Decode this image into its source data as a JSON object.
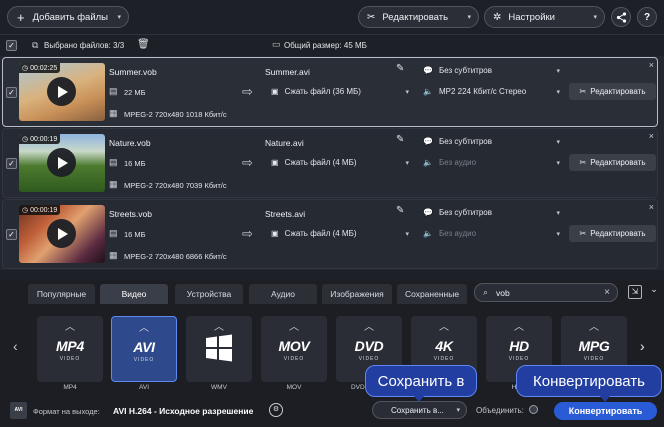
{
  "toolbar": {
    "add_files": "Добавить файлы",
    "edit": "Редактировать",
    "settings": "Настройки"
  },
  "selection": {
    "selected": "Выбрано файлов: 3/3",
    "total_size": "Общий размер: 45 МБ"
  },
  "files": [
    {
      "duration": "00:02:25",
      "src_name": "Summer.vob",
      "size": "22 МБ",
      "codec": "MPEG-2 720x480 1018 Кбит/с",
      "out_name": "Summer.avi",
      "compress": "Сжать файл (36 МБ)",
      "subtitles": "Без субтитров",
      "audio": "MP2 224 Кбит/с Стерео",
      "audio_disabled": false,
      "edit": "Редактировать"
    },
    {
      "duration": "00:00:19",
      "src_name": "Nature.vob",
      "size": "16 МБ",
      "codec": "MPEG-2 720x480 7039 Кбит/с",
      "out_name": "Nature.avi",
      "compress": "Сжать файл (4 МБ)",
      "subtitles": "Без субтитров",
      "audio": "Без аудио",
      "audio_disabled": true,
      "edit": "Редактировать"
    },
    {
      "duration": "00:00:19",
      "src_name": "Streets.vob",
      "size": "16 МБ",
      "codec": "MPEG-2 720x480 6866 Кбит/с",
      "out_name": "Streets.avi",
      "compress": "Сжать файл (4 МБ)",
      "subtitles": "Без субтитров",
      "audio": "Без аудио",
      "audio_disabled": true,
      "edit": "Редактировать"
    }
  ],
  "tabs": [
    "Популярные",
    "Видео",
    "Устройства",
    "Аудио",
    "Изображения",
    "Сохраненные"
  ],
  "active_tab": "Видео",
  "search": {
    "value": "vob"
  },
  "formats": [
    {
      "logo": "MP4",
      "sub": "VIDEO",
      "label": "MP4"
    },
    {
      "logo": "AVI",
      "sub": "VIDEO",
      "label": "AVI"
    },
    {
      "logo": "",
      "sub": "",
      "label": "WMV"
    },
    {
      "logo": "MOV",
      "sub": "VIDEO",
      "label": "MOV"
    },
    {
      "logo": "DVD",
      "sub": "VIDEO",
      "label": "DVD-совм..."
    },
    {
      "logo": "4K",
      "sub": "VIDEO",
      "label": ""
    },
    {
      "logo": "HD",
      "sub": "VIDEO",
      "label": "HD..."
    },
    {
      "logo": "MPG",
      "sub": "VIDEO",
      "label": "MPG"
    }
  ],
  "footer": {
    "output_format_label": "Формат на выходе:",
    "output_format_value": "AVI H.264 - Исходное разрешение",
    "save_to": "Сохранить в...",
    "merge": "Объединить:",
    "convert": "Конвертировать"
  },
  "callouts": {
    "save_to": "Сохранить в",
    "convert": "Конвертировать"
  },
  "colors": {
    "accent": "#2f4a8c",
    "callout": "#213ea0",
    "convert_button": "#2a5bd7"
  }
}
